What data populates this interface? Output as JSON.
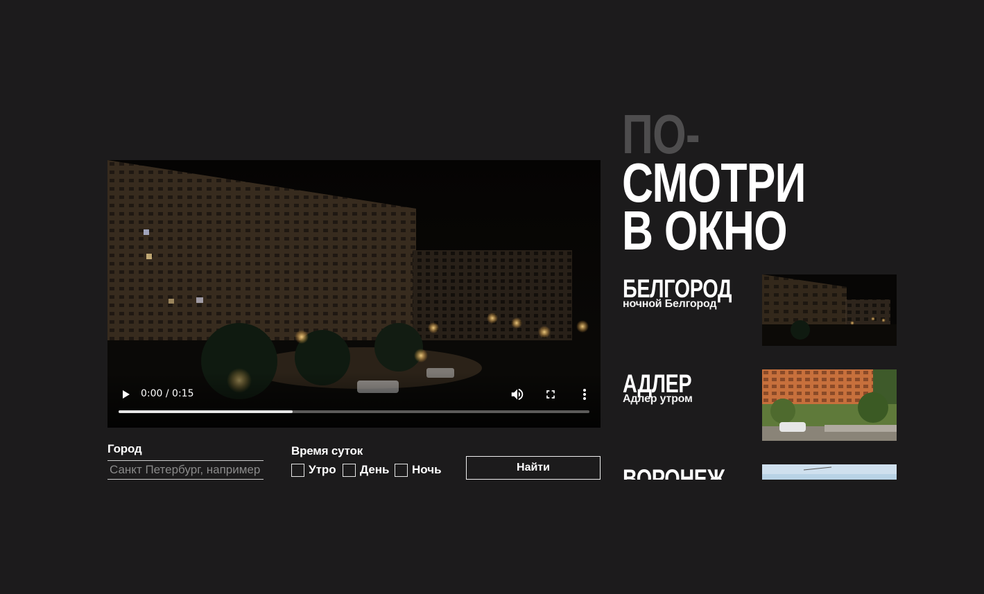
{
  "video": {
    "time": "0:00 / 0:15",
    "progress_fraction": 0.37
  },
  "title": {
    "line1": "ПО-",
    "line2": "СМОТРИ",
    "line3": "В ОКНО"
  },
  "form": {
    "city_label": "Город",
    "city_placeholder": "Санкт Петербург, например",
    "time_label": "Время суток",
    "checkboxes": [
      "Утро",
      "День",
      "Ночь"
    ],
    "find_label": "Найти"
  },
  "list": [
    {
      "city": "БЕЛГОРОД",
      "desc": "ночной Белгород"
    },
    {
      "city": "АДЛЕР",
      "desc": "Адлер утром"
    },
    {
      "city": "ВОРОНЕЖ",
      "desc": ""
    }
  ],
  "colors": {
    "background": "#1c1b1c",
    "title_accent": "#4e4d4e"
  }
}
